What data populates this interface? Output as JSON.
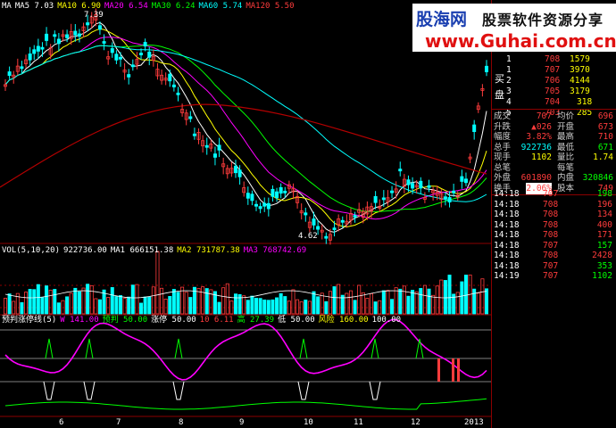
{
  "colors": {
    "up": "#ff3c3c",
    "down": "#00ffff",
    "white": "#ffffff",
    "yellow": "#ffff00",
    "magenta": "#ff00ff",
    "green": "#00ff00",
    "grid": "#8b0000",
    "red_line": "#b40000"
  },
  "ma_legend": [
    {
      "label": "MA",
      "color": "#ffffff"
    },
    {
      "label": "MA5 7.03",
      "color": "#ffffff"
    },
    {
      "label": "MA10 6.90",
      "color": "#ffff00"
    },
    {
      "label": "MA20 6.54",
      "color": "#ff00ff"
    },
    {
      "label": "MA30 6.24",
      "color": "#00ff00"
    },
    {
      "label": "MA60 5.74",
      "color": "#00ffff"
    },
    {
      "label": "MA120 5.50",
      "color": "#ff3c3c"
    }
  ],
  "price_labels": {
    "high": "7.39",
    "low": "4.62"
  },
  "vol_legend": [
    {
      "label": "VOL(5,10,20)",
      "color": "#ffffff"
    },
    {
      "label": "922736.00",
      "color": "#ffffff"
    },
    {
      "label": "MA1 666151.38",
      "color": "#ffffff"
    },
    {
      "label": "MA2 731787.38",
      "color": "#ffff00"
    },
    {
      "label": "MA3 768742.69",
      "color": "#ff00ff"
    }
  ],
  "ind_legend": [
    {
      "label": "预判涨停线(5)",
      "color": "#ffffff"
    },
    {
      "label": "W 141.00",
      "color": "#ff00ff"
    },
    {
      "label": "预判 50.00",
      "color": "#00ff00"
    },
    {
      "label": "涨停 50.00",
      "color": "#ffffff"
    },
    {
      "label": "10 6.11",
      "color": "#ff3c3c"
    },
    {
      "label": "高 27.39",
      "color": "#00ff00"
    },
    {
      "label": "低 50.00",
      "color": "#ffffff"
    },
    {
      "label": "风险 160.00",
      "color": "#ffff00"
    },
    {
      "label": "100.00",
      "color": "#ffffff"
    }
  ],
  "x_axis": [
    "6",
    "7",
    "8",
    "9",
    "10",
    "11",
    "12",
    "2013"
  ],
  "brand": {
    "logo": "股海网",
    "tagline": "股票软件资源分享",
    "url": "www.Guhai.com.cn"
  },
  "order_book": {
    "buy_label": "买",
    "sell_label": "盘",
    "rows": [
      {
        "n": "1",
        "price": "708",
        "vol": "1579"
      },
      {
        "n": "1",
        "price": "707",
        "vol": "3970"
      },
      {
        "n": "2",
        "price": "706",
        "vol": "4144"
      },
      {
        "n": "3",
        "price": "705",
        "vol": "3179"
      },
      {
        "n": "4",
        "price": "704",
        "vol": "318"
      },
      {
        "n": "5",
        "price": "703",
        "vol": "285"
      }
    ]
  },
  "stats": [
    {
      "l": "成交",
      "v": "707",
      "l2": "均价",
      "v2": "696"
    },
    {
      "l": "升跌",
      "v": "▲026",
      "l2": "开盘",
      "v2": "673"
    },
    {
      "l": "幅度",
      "v": "3.82%",
      "l2": "最高",
      "v2": "710"
    },
    {
      "l": "总手",
      "v": "922736",
      "l2": "最低",
      "v2": "671"
    },
    {
      "l": "现手",
      "v": "1102",
      "l2": "量比",
      "v2": "1.74"
    },
    {
      "l": "总笔",
      "v": "",
      "l2": "每笔",
      "v2": ""
    },
    {
      "l": "外盘",
      "v": "601890",
      "l2": "内盘",
      "v2": "320846"
    },
    {
      "l": "换手",
      "v": "2.06%",
      "l2": "股本",
      "v2": "749"
    }
  ],
  "ticks": [
    {
      "t": "14:18",
      "p": "707",
      "v": "198"
    },
    {
      "t": "14:18",
      "p": "708",
      "v": "196"
    },
    {
      "t": "14:18",
      "p": "708",
      "v": "134"
    },
    {
      "t": "14:18",
      "p": "708",
      "v": "400"
    },
    {
      "t": "14:18",
      "p": "708",
      "v": "171"
    },
    {
      "t": "14:18",
      "p": "707",
      "v": "157"
    },
    {
      "t": "14:18",
      "p": "708",
      "v": "2428"
    },
    {
      "t": "14:18",
      "p": "707",
      "v": "353"
    },
    {
      "t": "14:19",
      "p": "707",
      "v": "1102"
    }
  ]
}
